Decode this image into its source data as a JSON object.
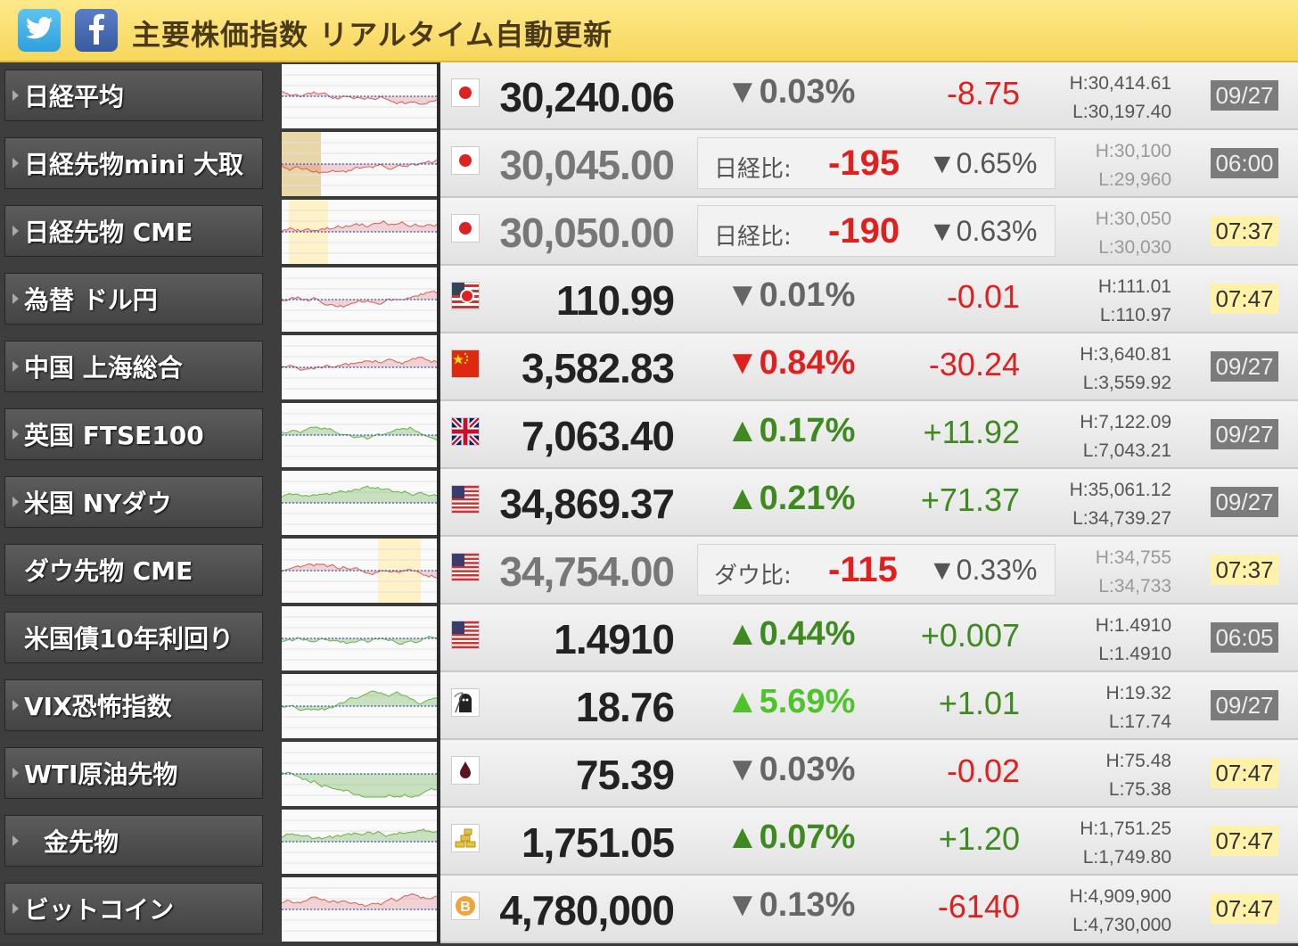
{
  "header": {
    "title": "主要株価指数 リアルタイム自動更新",
    "twitter_icon": "twitter-bird-icon",
    "facebook_icon": "facebook-f-icon"
  },
  "colors": {
    "up": "#3f8a20",
    "down": "#e0201e",
    "vix_up": "#4fc32a",
    "header_bg": "#f7d65c"
  },
  "rows": [
    {
      "name": "日経平均",
      "arrow": true,
      "flag": "japan",
      "price": "30,240.06",
      "price_grey": false,
      "type": "index",
      "pct": "▼0.03%",
      "pct_class": "dgrey",
      "change": "-8.75",
      "change_class": "red",
      "high": "H:30,414.61",
      "low": "L:30,197.40",
      "time": "09/27",
      "time_style": "grey"
    },
    {
      "name": "日経先物mini 大取",
      "arrow": true,
      "flag": "japan",
      "price": "30,045.00",
      "price_grey": true,
      "type": "future",
      "diff_label": "日経比:",
      "diff": "-195",
      "pct": "▼0.65%",
      "high": "H:30,100",
      "low": "L:29,960",
      "time": "06:00",
      "time_style": "grey"
    },
    {
      "name": "日経先物 CME",
      "arrow": true,
      "flag": "japan",
      "price": "30,050.00",
      "price_grey": true,
      "type": "future",
      "diff_label": "日経比:",
      "diff": "-190",
      "pct": "▼0.63%",
      "high": "H:30,050",
      "low": "L:30,030",
      "time": "07:37",
      "time_style": "yellow"
    },
    {
      "name": "為替 ドル円",
      "arrow": true,
      "flag": "usjp",
      "price": "110.99",
      "price_grey": false,
      "type": "index",
      "pct": "▼0.01%",
      "pct_class": "dgrey",
      "change": "-0.01",
      "change_class": "red",
      "high": "H:111.01",
      "low": "L:110.97",
      "time": "07:47",
      "time_style": "yellow"
    },
    {
      "name": "中国 上海総合",
      "arrow": true,
      "flag": "china",
      "price": "3,582.83",
      "price_grey": false,
      "type": "index",
      "pct": "▼0.84%",
      "pct_class": "red",
      "change": "-30.24",
      "change_class": "red",
      "high": "H:3,640.81",
      "low": "L:3,559.92",
      "time": "09/27",
      "time_style": "grey"
    },
    {
      "name": "英国 FTSE100",
      "arrow": true,
      "flag": "uk",
      "price": "7,063.40",
      "price_grey": false,
      "type": "index",
      "pct": "▲0.17%",
      "pct_class": "green",
      "change": "+11.92",
      "change_class": "green",
      "high": "H:7,122.09",
      "low": "L:7,043.21",
      "time": "09/27",
      "time_style": "grey"
    },
    {
      "name": "米国 NYダウ",
      "arrow": true,
      "flag": "us",
      "price": "34,869.37",
      "price_grey": false,
      "type": "index",
      "pct": "▲0.21%",
      "pct_class": "green",
      "change": "+71.37",
      "change_class": "green",
      "high": "H:35,061.12",
      "low": "L:34,739.27",
      "time": "09/27",
      "time_style": "grey"
    },
    {
      "name": "ダウ先物 CME",
      "arrow": false,
      "flag": "us",
      "price": "34,754.00",
      "price_grey": true,
      "type": "future",
      "diff_label": "ダウ比:",
      "diff": "-115",
      "pct": "▼0.33%",
      "high": "H:34,755",
      "low": "L:34,733",
      "time": "07:37",
      "time_style": "yellow"
    },
    {
      "name": "米国債10年利回り",
      "arrow": false,
      "flag": "us",
      "price": "1.4910",
      "price_grey": false,
      "type": "index",
      "pct": "▲0.44%",
      "pct_class": "green",
      "change": "+0.007",
      "change_class": "green",
      "high": "H:1.4910",
      "low": "L:1.4910",
      "time": "06:05",
      "time_style": "grey"
    },
    {
      "name": "VIX恐怖指数",
      "arrow": true,
      "flag": "reaper",
      "price": "18.76",
      "price_grey": false,
      "type": "index",
      "pct": "▲5.69%",
      "pct_class": "lime",
      "change": "+1.01",
      "change_class": "green",
      "high": "H:19.32",
      "low": "L:17.74",
      "time": "09/27",
      "time_style": "grey"
    },
    {
      "name": "WTI原油先物",
      "arrow": true,
      "flag": "oil",
      "price": "75.39",
      "price_grey": false,
      "type": "index",
      "pct": "▼0.03%",
      "pct_class": "dgrey",
      "change": "-0.02",
      "change_class": "red",
      "high": "H:75.48",
      "low": "L:75.38",
      "time": "07:47",
      "time_style": "yellow"
    },
    {
      "name": "金先物",
      "arrow": true,
      "flag": "gold",
      "indent": true,
      "price": "1,751.05",
      "price_grey": false,
      "type": "index",
      "pct": "▲0.07%",
      "pct_class": "green",
      "change": "+1.20",
      "change_class": "green",
      "high": "H:1,751.25",
      "low": "L:1,749.80",
      "time": "07:47",
      "time_style": "yellow"
    },
    {
      "name": "ビットコイン",
      "arrow": true,
      "flag": "bitcoin",
      "price": "4,780,000",
      "price_grey": false,
      "type": "index",
      "pct": "▼0.13%",
      "pct_class": "dgrey",
      "change": "-6140",
      "change_class": "red",
      "high": "H:4,909,900",
      "low": "L:4,730,000",
      "time": "07:47",
      "time_style": "yellow"
    }
  ]
}
